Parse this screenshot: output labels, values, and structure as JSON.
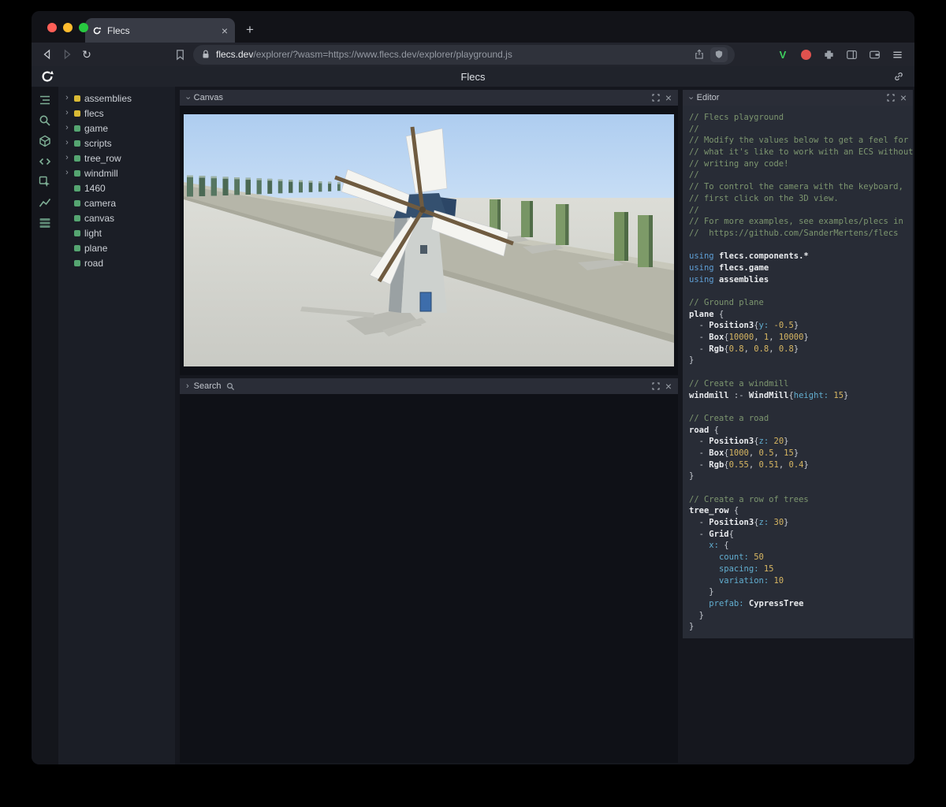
{
  "browser": {
    "tab": {
      "title": "Flecs"
    },
    "url": {
      "domain": "flecs.dev",
      "path": "/explorer/?wasm=https://www.flecs.dev/explorer/playground.js"
    }
  },
  "app": {
    "title": "Flecs"
  },
  "icons": {
    "close": "×",
    "plus": "+",
    "chevron": "›",
    "reload": "↻",
    "v_extension": "V"
  },
  "icon_strip": [
    "entity-tree",
    "search",
    "entities",
    "code",
    "inspect",
    "chart",
    "queries"
  ],
  "tree": {
    "items": [
      {
        "label": "assemblies",
        "color": "#d9ba35",
        "expandable": true
      },
      {
        "label": "flecs",
        "color": "#d9ba35",
        "expandable": true
      },
      {
        "label": "game",
        "color": "#55a571",
        "expandable": true
      },
      {
        "label": "scripts",
        "color": "#55a571",
        "expandable": true
      },
      {
        "label": "tree_row",
        "color": "#55a571",
        "expandable": true
      },
      {
        "label": "windmill",
        "color": "#55a571",
        "expandable": true
      },
      {
        "label": "1460",
        "color": "#55a571",
        "expandable": false
      },
      {
        "label": "camera",
        "color": "#55a571",
        "expandable": false
      },
      {
        "label": "canvas",
        "color": "#55a571",
        "expandable": false
      },
      {
        "label": "light",
        "color": "#55a571",
        "expandable": false
      },
      {
        "label": "plane",
        "color": "#55a571",
        "expandable": false
      },
      {
        "label": "road",
        "color": "#55a571",
        "expandable": false
      }
    ]
  },
  "panels": {
    "canvas": {
      "title": "Canvas"
    },
    "search": {
      "title": "Search"
    },
    "editor": {
      "title": "Editor",
      "code": [
        [
          [
            "c",
            "// Flecs playground"
          ]
        ],
        [
          [
            "c",
            "//"
          ]
        ],
        [
          [
            "c",
            "// Modify the values below to get a feel for"
          ]
        ],
        [
          [
            "c",
            "// what it's like to work with an ECS without"
          ]
        ],
        [
          [
            "c",
            "// writing any code!"
          ]
        ],
        [
          [
            "c",
            "//"
          ]
        ],
        [
          [
            "c",
            "// To control the camera with the keyboard,"
          ]
        ],
        [
          [
            "c",
            "// first click on the 3D view."
          ]
        ],
        [
          [
            "c",
            "//"
          ]
        ],
        [
          [
            "c",
            "// For more examples, see examples/plecs in"
          ]
        ],
        [
          [
            "c",
            "//  https://github.com/SanderMertens/flecs"
          ]
        ],
        [],
        [
          [
            "k",
            "using "
          ],
          [
            "e",
            "flecs.components.*"
          ]
        ],
        [
          [
            "k",
            "using "
          ],
          [
            "e",
            "flecs.game"
          ]
        ],
        [
          [
            "k",
            "using "
          ],
          [
            "e",
            "assemblies"
          ]
        ],
        [],
        [
          [
            "c",
            "// Ground plane"
          ]
        ],
        [
          [
            "e",
            "plane"
          ],
          [
            "p",
            " {"
          ]
        ],
        [
          [
            "p",
            "  - "
          ],
          [
            "e",
            "Position3"
          ],
          [
            "p",
            "{"
          ],
          [
            "a",
            "y:"
          ],
          [
            "p",
            " "
          ],
          [
            "n",
            "-0.5"
          ],
          [
            "p",
            "}"
          ]
        ],
        [
          [
            "p",
            "  - "
          ],
          [
            "e",
            "Box"
          ],
          [
            "p",
            "{"
          ],
          [
            "n",
            "10000"
          ],
          [
            "p",
            ", "
          ],
          [
            "n",
            "1"
          ],
          [
            "p",
            ", "
          ],
          [
            "n",
            "10000"
          ],
          [
            "p",
            "}"
          ]
        ],
        [
          [
            "p",
            "  - "
          ],
          [
            "e",
            "Rgb"
          ],
          [
            "p",
            "{"
          ],
          [
            "n",
            "0.8"
          ],
          [
            "p",
            ", "
          ],
          [
            "n",
            "0.8"
          ],
          [
            "p",
            ", "
          ],
          [
            "n",
            "0.8"
          ],
          [
            "p",
            "}"
          ]
        ],
        [
          [
            "p",
            "}"
          ]
        ],
        [],
        [
          [
            "c",
            "// Create a windmill"
          ]
        ],
        [
          [
            "e",
            "windmill"
          ],
          [
            "p",
            " :- "
          ],
          [
            "e",
            "WindMill"
          ],
          [
            "p",
            "{"
          ],
          [
            "a",
            "height:"
          ],
          [
            "p",
            " "
          ],
          [
            "n",
            "15"
          ],
          [
            "p",
            "}"
          ]
        ],
        [],
        [
          [
            "c",
            "// Create a road"
          ]
        ],
        [
          [
            "e",
            "road"
          ],
          [
            "p",
            " {"
          ]
        ],
        [
          [
            "p",
            "  - "
          ],
          [
            "e",
            "Position3"
          ],
          [
            "p",
            "{"
          ],
          [
            "a",
            "z:"
          ],
          [
            "p",
            " "
          ],
          [
            "n",
            "20"
          ],
          [
            "p",
            "}"
          ]
        ],
        [
          [
            "p",
            "  - "
          ],
          [
            "e",
            "Box"
          ],
          [
            "p",
            "{"
          ],
          [
            "n",
            "1000"
          ],
          [
            "p",
            ", "
          ],
          [
            "n",
            "0.5"
          ],
          [
            "p",
            ", "
          ],
          [
            "n",
            "15"
          ],
          [
            "p",
            "}"
          ]
        ],
        [
          [
            "p",
            "  - "
          ],
          [
            "e",
            "Rgb"
          ],
          [
            "p",
            "{"
          ],
          [
            "n",
            "0.55"
          ],
          [
            "p",
            ", "
          ],
          [
            "n",
            "0.51"
          ],
          [
            "p",
            ", "
          ],
          [
            "n",
            "0.4"
          ],
          [
            "p",
            "}"
          ]
        ],
        [
          [
            "p",
            "}"
          ]
        ],
        [],
        [
          [
            "c",
            "// Create a row of trees"
          ]
        ],
        [
          [
            "e",
            "tree_row"
          ],
          [
            "p",
            " {"
          ]
        ],
        [
          [
            "p",
            "  - "
          ],
          [
            "e",
            "Position3"
          ],
          [
            "p",
            "{"
          ],
          [
            "a",
            "z:"
          ],
          [
            "p",
            " "
          ],
          [
            "n",
            "30"
          ],
          [
            "p",
            "}"
          ]
        ],
        [
          [
            "p",
            "  - "
          ],
          [
            "e",
            "Grid"
          ],
          [
            "p",
            "{"
          ]
        ],
        [
          [
            "p",
            "    "
          ],
          [
            "a",
            "x:"
          ],
          [
            "p",
            " {"
          ]
        ],
        [
          [
            "p",
            "      "
          ],
          [
            "a",
            "count:"
          ],
          [
            "p",
            " "
          ],
          [
            "n",
            "50"
          ]
        ],
        [
          [
            "p",
            "      "
          ],
          [
            "a",
            "spacing:"
          ],
          [
            "p",
            " "
          ],
          [
            "n",
            "15"
          ]
        ],
        [
          [
            "p",
            "      "
          ],
          [
            "a",
            "variation:"
          ],
          [
            "p",
            " "
          ],
          [
            "n",
            "10"
          ]
        ],
        [
          [
            "p",
            "    }"
          ]
        ],
        [
          [
            "p",
            "    "
          ],
          [
            "a",
            "prefab:"
          ],
          [
            "p",
            " "
          ],
          [
            "e",
            "CypressTree"
          ]
        ],
        [
          [
            "p",
            "  }"
          ]
        ],
        [
          [
            "p",
            "}"
          ]
        ]
      ]
    }
  },
  "colors": {
    "accent_green": "#55a571",
    "accent_yellow": "#d9ba35",
    "sky": "#b5d2ee",
    "ground": "#d6d7d1",
    "editor_bg": "#282c36"
  }
}
